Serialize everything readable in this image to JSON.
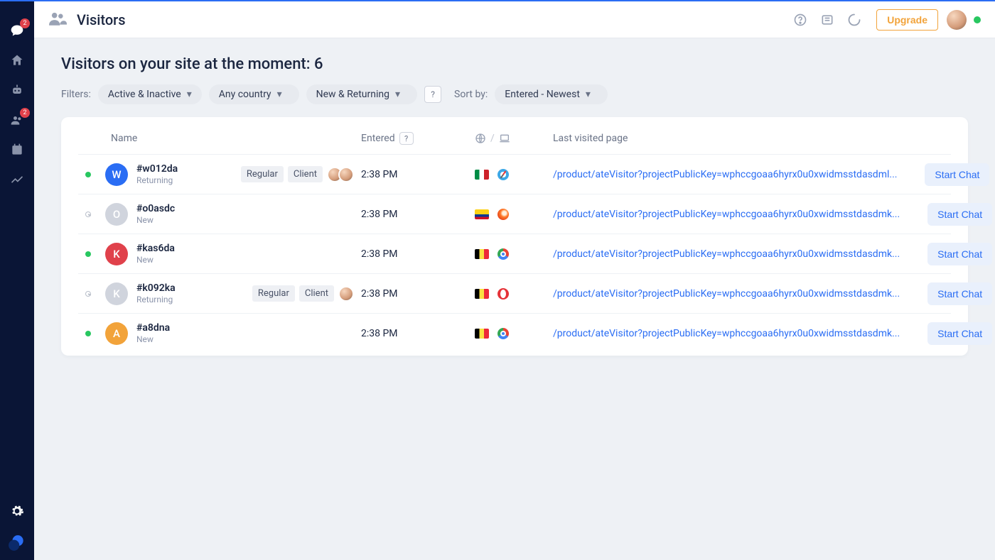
{
  "sidebar": {
    "badges": {
      "chat": "2",
      "contacts": "2"
    }
  },
  "header": {
    "title": "Visitors",
    "upgrade": "Upgrade"
  },
  "page": {
    "heading_prefix": "Visitors on your site at the moment: ",
    "count": "6",
    "filters_label": "Filters:",
    "sort_label": "Sort by:",
    "filter_status": "Active & Inactive",
    "filter_country": "Any country",
    "filter_returning": "New & Returning",
    "sort_value": "Entered - Newest",
    "help": "?"
  },
  "table": {
    "col_name": "Name",
    "col_entered": "Entered",
    "col_entered_help": "?",
    "col_origin_sep": "/",
    "col_page": "Last visited page",
    "start_chat": "Start Chat",
    "tags": {
      "regular": "Regular",
      "client": "Client"
    },
    "rows": [
      {
        "status": "green",
        "avatar": "W",
        "avatarColor": "blue",
        "id": "#w012da",
        "sub": "Returning",
        "tags": [
          "regular",
          "client"
        ],
        "ops": 2,
        "entered": "2:38 PM",
        "flag": "it",
        "browser": "safari",
        "url": "/product/ateVisitor?projectPublicKey=wphccgoaa6hyrx0u0xwidmsstdasdml..."
      },
      {
        "status": "idle",
        "avatar": "O",
        "avatarColor": "gray",
        "id": "#o0asdc",
        "sub": "New",
        "tags": [],
        "ops": 0,
        "entered": "2:38 PM",
        "flag": "co",
        "browser": "firefox",
        "url": "/product/ateVisitor?projectPublicKey=wphccgoaa6hyrx0u0xwidmsstdasdmk..."
      },
      {
        "status": "green",
        "avatar": "K",
        "avatarColor": "red",
        "id": "#kas6da",
        "sub": "New",
        "tags": [],
        "ops": 0,
        "entered": "2:38 PM",
        "flag": "be",
        "browser": "chrome",
        "url": "/product/ateVisitor?projectPublicKey=wphccgoaa6hyrx0u0xwidmsstdasdmk..."
      },
      {
        "status": "idle",
        "avatar": "K",
        "avatarColor": "gray",
        "id": "#k092ka",
        "sub": "Returning",
        "tags": [
          "regular",
          "client"
        ],
        "ops": 1,
        "entered": "2:38 PM",
        "flag": "be",
        "browser": "opera",
        "url": "/product/ateVisitor?projectPublicKey=wphccgoaa6hyrx0u0xwidmsstdasdmk..."
      },
      {
        "status": "green",
        "avatar": "A",
        "avatarColor": "yellow",
        "id": "#a8dna",
        "sub": "New",
        "tags": [],
        "ops": 0,
        "entered": "2:38 PM",
        "flag": "be",
        "browser": "chrome",
        "url": "/product/ateVisitor?projectPublicKey=wphccgoaa6hyrx0u0xwidmsstdasdmk..."
      }
    ]
  }
}
